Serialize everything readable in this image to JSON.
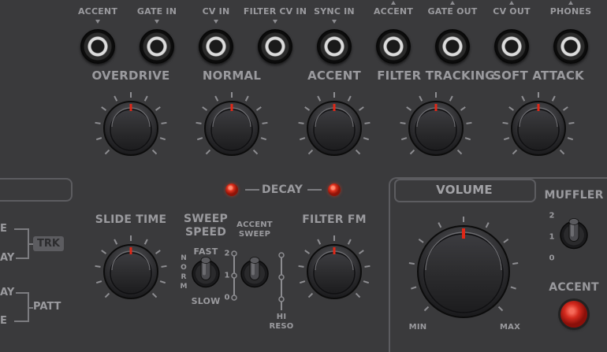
{
  "jacks": {
    "inputs": [
      {
        "label": "ACCENT",
        "dir": "in"
      },
      {
        "label": "GATE IN",
        "dir": "in"
      },
      {
        "label": "CV IN",
        "dir": "in"
      },
      {
        "label": "FILTER CV IN",
        "dir": "in"
      },
      {
        "label": "SYNC IN",
        "dir": "in"
      }
    ],
    "outputs": [
      {
        "label": "ACCENT",
        "dir": "out"
      },
      {
        "label": "GATE OUT",
        "dir": "out"
      },
      {
        "label": "CV OUT",
        "dir": "out"
      },
      {
        "label": "PHONES",
        "dir": "out"
      }
    ]
  },
  "top_knobs": [
    {
      "label": "OVERDRIVE",
      "value": 0.5
    },
    {
      "label": "NORMAL",
      "value": 0.5
    },
    {
      "label": "ACCENT",
      "value": 0.5
    },
    {
      "label": "FILTER TRACKING",
      "value": 0.5
    },
    {
      "label": "SOFT ATTACK",
      "value": 0.5
    }
  ],
  "decay": {
    "label": "DECAY"
  },
  "lower": {
    "slide_time": {
      "label": "SLIDE TIME",
      "value": 0.5
    },
    "sweep_speed": {
      "label_line1": "SWEEP",
      "label_line2": "SPEED",
      "fast": "FAST",
      "norm": "N O R M",
      "slow": "SLOW"
    },
    "accent_sweep": {
      "label_line1": "ACCENT",
      "label_line2": "SWEEP",
      "positions": [
        "2",
        "1",
        "0"
      ]
    },
    "filter_fm": {
      "label": "FILTER FM",
      "value": 0.5
    },
    "hi_reso": {
      "label_line1": "HI",
      "label_line2": "RESO"
    }
  },
  "volume": {
    "label": "VOLUME",
    "min": "MIN",
    "max": "MAX",
    "value": 0.5
  },
  "muffler": {
    "label": "MUFFLER",
    "positions": [
      "2",
      "1",
      "0"
    ]
  },
  "accent_button": {
    "label": "ACCENT"
  },
  "left_panel": {
    "trk": "TRK",
    "patt": "PATT",
    "row1": "E",
    "row2": "AY",
    "row3": "AY",
    "row4": "E"
  },
  "colors": {
    "panel": "#3a3a3c",
    "text": "#9a9a9e",
    "led": "#e0321e",
    "indicator": "#e02818"
  }
}
